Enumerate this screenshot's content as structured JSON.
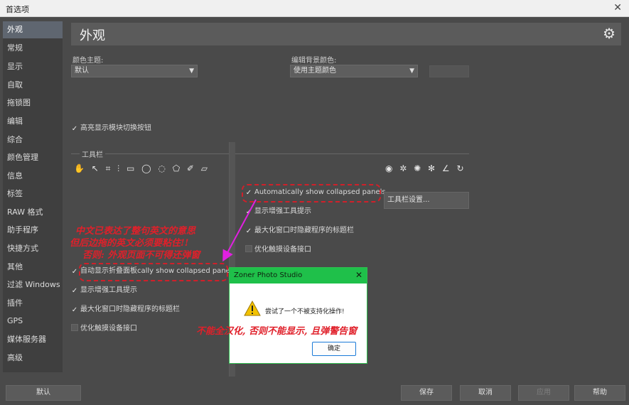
{
  "window": {
    "title": "首选项",
    "close_glyph": "✕"
  },
  "sidebar": {
    "items": [
      "外观",
      "常规",
      "显示",
      "自取",
      "拖锁图",
      "编辑",
      "综合",
      "颜色管理",
      "信息",
      "标签",
      "RAW 格式",
      "助手程序",
      "快捷方式",
      "其他",
      "过滤 Windows",
      "插件",
      "GPS",
      "媒体服务器",
      "高级"
    ],
    "active_index": 0
  },
  "header": {
    "title": "外观",
    "gear_icon": "gear-icon"
  },
  "theme": {
    "label": "颜色主题:",
    "value": "默认"
  },
  "bg": {
    "label": "编辑背景颜色:",
    "value": "使用主题颜色"
  },
  "highlight_check": {
    "label": "高亮显示模块切换按钮",
    "checked": true
  },
  "toolbar_group": {
    "label": "工具栏",
    "tools_left": "✋ ↖ ⌗ ⫶ ▭ ◯ ◌ ⬠ ✐ ▱",
    "tools_right": "◉ ✲ ✺ ✻ ∠ ↻"
  },
  "right_checks": {
    "auto": {
      "label": "Automatically show collapsed panels",
      "checked": true
    },
    "hints": {
      "label": "显示增强工具提示",
      "checked": false
    },
    "maximize": {
      "label": "最大化窗口时隐藏程序的标题栏",
      "checked": true
    },
    "touch": {
      "label": "优化触摸设备接口",
      "checked": false
    }
  },
  "toolbar_settings_button": {
    "label": "工具栏设置..."
  },
  "left_checks": {
    "auto": {
      "label": "自动显示折叠面板cally show collapsed panels",
      "checked": true
    },
    "hints": {
      "label": "显示增强工具提示",
      "checked": true
    },
    "maximize": {
      "label": "最大化窗口时隐藏程序的标题栏",
      "checked": true
    },
    "touch": {
      "label": "优化触摸设备接口",
      "checked": false
    }
  },
  "annotations": {
    "line1": "中文已表达了整句英文的意思",
    "line2": "但后边拖的英文必须要粘住!!",
    "line3": "否则: 外观页面不可得还弹窗",
    "bottom": "不能全汉化, 否则不能显示, 且弹警告窗",
    "color": "#e0202a"
  },
  "dialog": {
    "title": "Zoner Photo Studio",
    "close_glyph": "✕",
    "message": "尝试了一个不被支持化操作!",
    "ok": "确定"
  },
  "footer": {
    "default": "默认",
    "save": "保存",
    "cancel": "取消",
    "apply": "应用",
    "help": "帮助"
  }
}
